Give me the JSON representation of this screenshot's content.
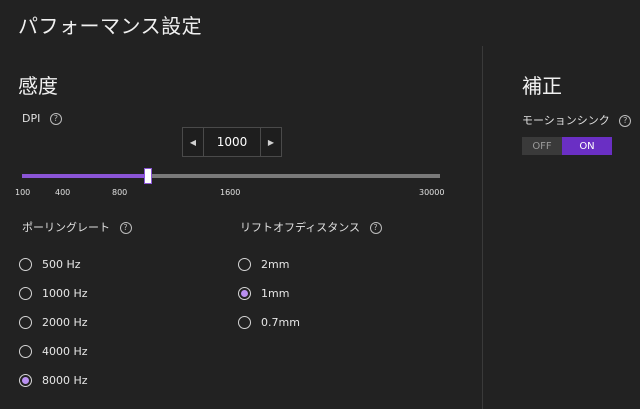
{
  "page": {
    "title": "パフォーマンス設定"
  },
  "sensitivity": {
    "heading": "感度",
    "dpi": {
      "label": "DPI",
      "value": "1000",
      "range": [
        100,
        30000
      ],
      "ticks": [
        "100",
        "400",
        "800",
        "1600",
        "30000"
      ],
      "decrement_icon": "caret-left-icon",
      "increment_icon": "caret-right-icon"
    },
    "polling_rate": {
      "label": "ポーリングレート",
      "options": [
        "500 Hz",
        "1000 Hz",
        "2000 Hz",
        "4000 Hz",
        "8000 Hz"
      ],
      "selected": "8000 Hz"
    },
    "lift_off": {
      "label": "リフトオフディスタンス",
      "options": [
        "2mm",
        "1mm",
        "0.7mm"
      ],
      "selected": "1mm"
    }
  },
  "correction": {
    "heading": "補正",
    "motion_sync": {
      "label": "モーションシンク",
      "off_label": "OFF",
      "on_label": "ON",
      "value": "ON"
    }
  },
  "colors": {
    "accent": "#8b55d6",
    "toggle_on": "#6a2fc4",
    "background": "#222222"
  }
}
